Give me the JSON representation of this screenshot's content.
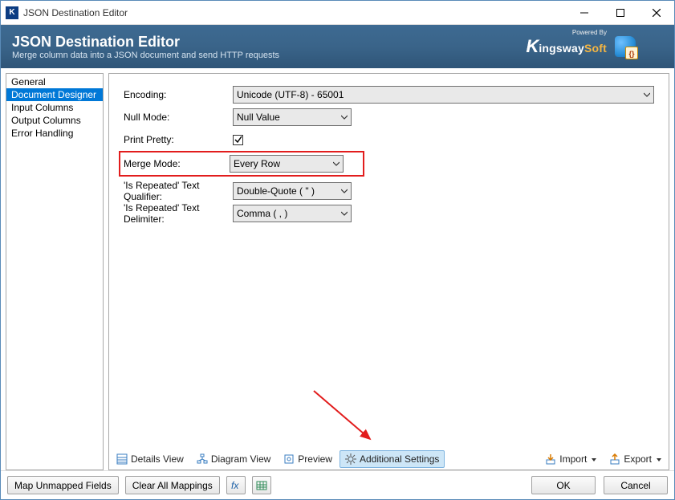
{
  "window": {
    "title": "JSON Destination Editor"
  },
  "header": {
    "title": "JSON Destination Editor",
    "subtitle": "Merge column data into a JSON document and send HTTP requests",
    "brand_powered": "Powered By",
    "brand_k": "K",
    "brand_ingsway": "ingsway",
    "brand_soft": "Soft"
  },
  "sidebar": {
    "items": [
      {
        "label": "General"
      },
      {
        "label": "Document Designer"
      },
      {
        "label": "Input Columns"
      },
      {
        "label": "Output Columns"
      },
      {
        "label": "Error Handling"
      }
    ],
    "selected_index": 1
  },
  "form": {
    "encoding": {
      "label": "Encoding:",
      "value": "Unicode (UTF-8) - 65001"
    },
    "null_mode": {
      "label": "Null Mode:",
      "value": "Null Value"
    },
    "print_pretty": {
      "label": "Print Pretty:",
      "checked": true
    },
    "merge_mode": {
      "label": "Merge Mode:",
      "value": "Every Row"
    },
    "repeat_qualifier": {
      "label": "'Is Repeated' Text Qualifier:",
      "value": "Double-Quote ( \" )"
    },
    "repeat_delimiter": {
      "label": "'Is Repeated' Text Delimiter:",
      "value": "Comma ( , )"
    }
  },
  "toolbar": {
    "details_view": "Details View",
    "diagram_view": "Diagram View",
    "preview": "Preview",
    "additional_settings": "Additional Settings",
    "import": "Import",
    "export": "Export"
  },
  "footer": {
    "map_unmapped": "Map Unmapped Fields",
    "clear_mappings": "Clear All Mappings",
    "ok": "OK",
    "cancel": "Cancel"
  }
}
